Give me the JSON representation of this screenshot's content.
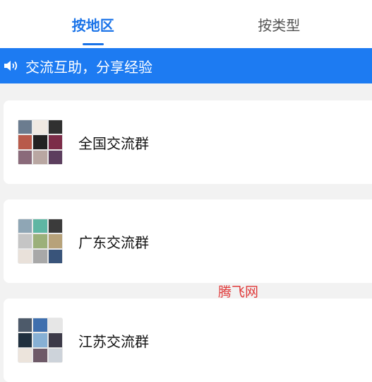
{
  "tabs": [
    {
      "label": "按地区",
      "active": true
    },
    {
      "label": "按类型",
      "active": false
    }
  ],
  "notice": {
    "icon": "speaker-icon",
    "text": "交流互助，分享经验"
  },
  "groups": [
    {
      "name": "全国交流群",
      "avatar_colors": [
        "#6b7c8f",
        "#f0e9e2",
        "#303030",
        "#b85a4a",
        "#222222",
        "#7c2c48",
        "#8a6a7a",
        "#b9a7a2",
        "#5c3e5e"
      ]
    },
    {
      "name": "广东交流群",
      "avatar_colors": [
        "#8fa6b5",
        "#5fb6a3",
        "#3b3b3b",
        "#c5c5c5",
        "#9bb07a",
        "#b7a27a",
        "#e9e1da",
        "#a8a8a8",
        "#39547a"
      ]
    },
    {
      "name": "江苏交流群",
      "avatar_colors": [
        "#4d5a6a",
        "#3f6fae",
        "#e6e6e6",
        "#20303f",
        "#87b0d4",
        "#3c3a48",
        "#ece4dc",
        "#6e5a68",
        "#cdd3da"
      ]
    }
  ],
  "watermark": "腾飞网",
  "colors": {
    "accent": "#1a73e8",
    "notice_bg": "#1d7bf2",
    "watermark": "#e03a3a"
  }
}
